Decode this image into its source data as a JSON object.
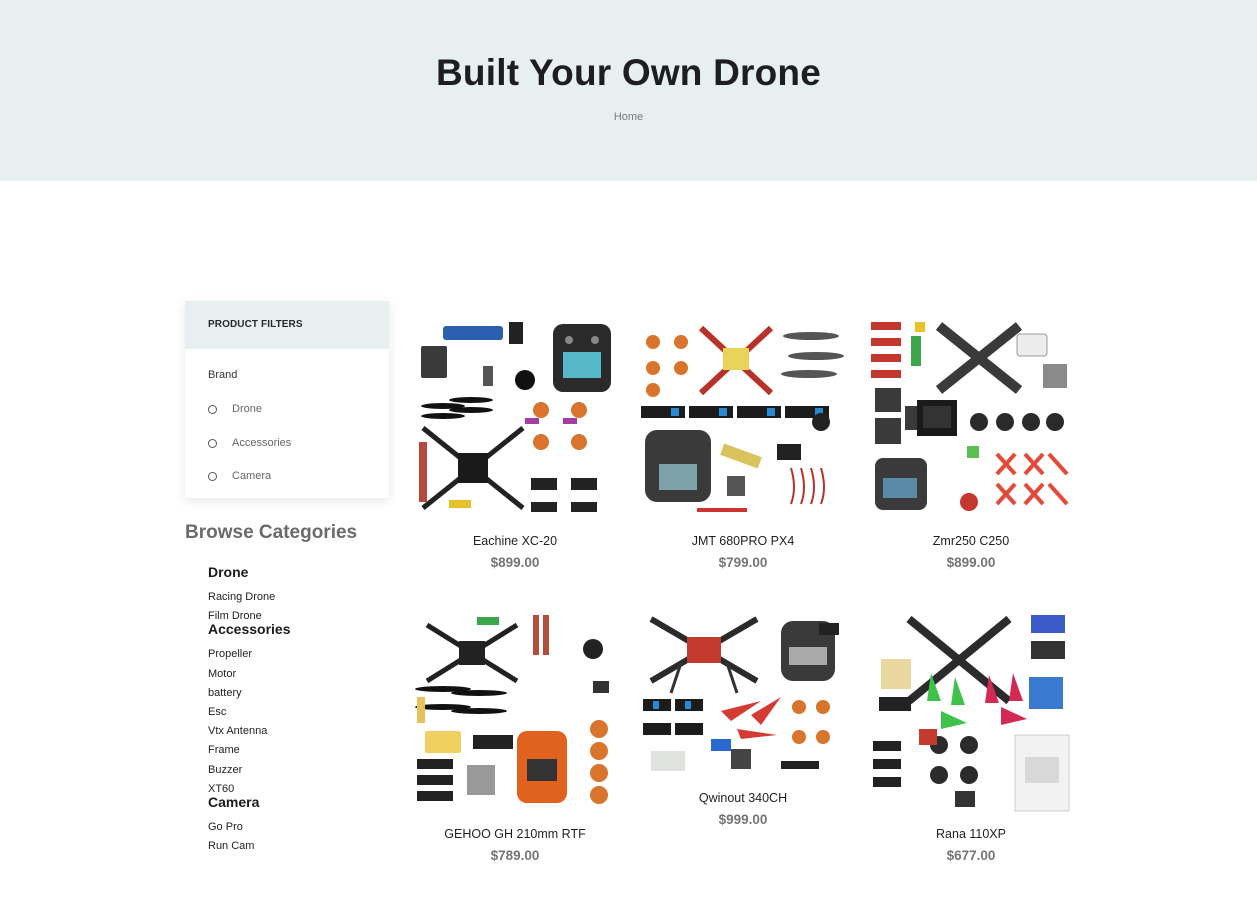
{
  "hero": {
    "title": "Built Your Own Drone",
    "breadcrumb": "Home"
  },
  "filters": {
    "heading": "PRODUCT FILTERS",
    "group_label": "Brand",
    "options": [
      "Drone",
      "Accessories",
      "Camera"
    ]
  },
  "browse": {
    "title": "Browse Categories",
    "groups": [
      {
        "heading": "Drone",
        "items": [
          "Racing Drone",
          "Film Drone"
        ]
      },
      {
        "heading": "Accessories",
        "items": [
          "Propeller",
          "Motor",
          "battery",
          "Esc",
          "Vtx Antenna",
          "Frame",
          "Buzzer",
          "XT60"
        ]
      },
      {
        "heading": "Camera",
        "items": [
          "Go Pro",
          "Run Cam"
        ]
      }
    ]
  },
  "products": [
    {
      "name": "Eachine XC-20",
      "price": "$899.00"
    },
    {
      "name": "JMT 680PRO PX4",
      "price": "$799.00"
    },
    {
      "name": "Zmr250 C250",
      "price": "$899.00"
    },
    {
      "name": "GEHOO GH 210mm RTF",
      "price": "$789.00"
    },
    {
      "name": "Qwinout 340CH",
      "price": "$999.00"
    },
    {
      "name": "Rana 110XP",
      "price": "$677.00"
    }
  ],
  "colors": {
    "hero_bg": "#e8eff1",
    "price": "#757575",
    "accent_orange": "#e8782a",
    "accent_red": "#e0473c",
    "accent_green": "#35c24a"
  }
}
